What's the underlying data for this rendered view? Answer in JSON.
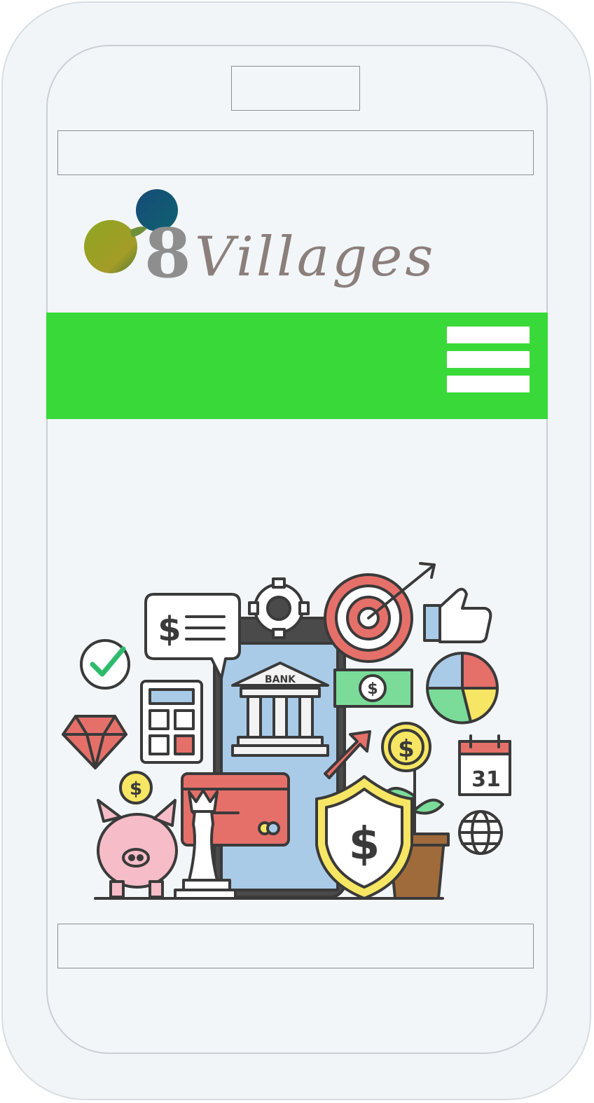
{
  "brand": {
    "logo_number": "8",
    "logo_word": "Villages"
  },
  "nav": {
    "menu_icon": "hamburger-menu-icon"
  },
  "hero": {
    "bank_label": "BANK",
    "calendar_day": "31",
    "dollar_sign": "$"
  },
  "colors": {
    "nav_bar": "#3ad93a",
    "phone_body": "#f1f5f8",
    "logo_green": "#9aa72a",
    "logo_blue": "#0f5476"
  }
}
